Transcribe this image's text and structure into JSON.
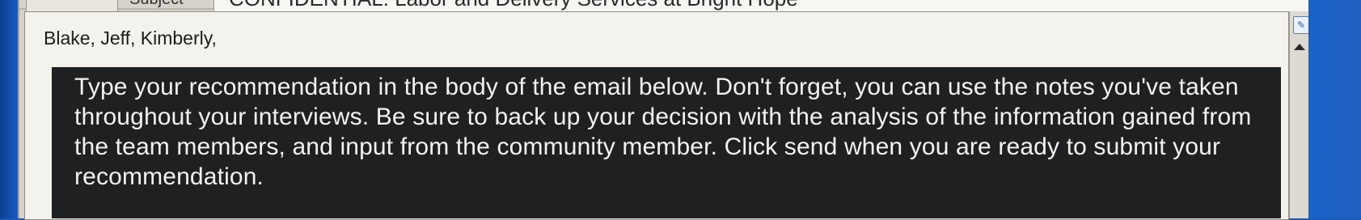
{
  "subject": {
    "label": "Subject",
    "value": "CONFIDENTIAL: Labor and Delivery Services at Bright Hope"
  },
  "email": {
    "greeting": "Blake, Jeff, Kimberly,"
  },
  "instruction": {
    "text": "Type your recommendation in the body of the email below. Don't forget, you can use the notes you've taken throughout your interviews. Be sure to back up your decision with the analysis of the information gained from the team members, and input from the community member. Click send when you are ready to submit your recommendation."
  },
  "scrollbar": {
    "top_icon": "notepad-icon",
    "up_icon": "scroll-up-arrow-icon"
  }
}
